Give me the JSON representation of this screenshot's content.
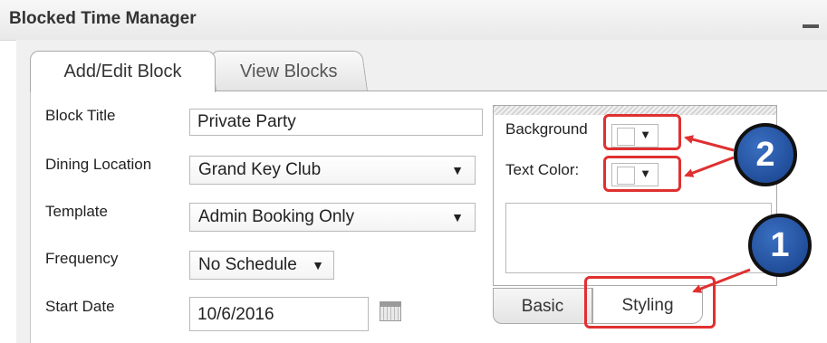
{
  "header": {
    "title": "Blocked Time Manager"
  },
  "tabs": [
    {
      "label": "Add/Edit Block"
    },
    {
      "label": "View Blocks"
    }
  ],
  "form": {
    "block_title": {
      "label": "Block Title",
      "value": "Private Party"
    },
    "dining_location": {
      "label": "Dining Location",
      "value": "Grand Key Club"
    },
    "template": {
      "label": "Template",
      "value": "Admin Booking Only"
    },
    "frequency": {
      "label": "Frequency",
      "value": "No Schedule"
    },
    "start_date": {
      "label": "Start Date",
      "value": "10/6/2016"
    }
  },
  "styling": {
    "background_label": "Background",
    "text_color_label": "Text Color:",
    "tabs": [
      {
        "label": "Basic"
      },
      {
        "label": "Styling"
      }
    ]
  },
  "annotations": {
    "badge_1": "1",
    "badge_2": "2"
  },
  "icons": {
    "dropdown": "▼"
  },
  "colors": {
    "annotation_red": "#e03030",
    "badge_blue": "#2a5aa8"
  }
}
